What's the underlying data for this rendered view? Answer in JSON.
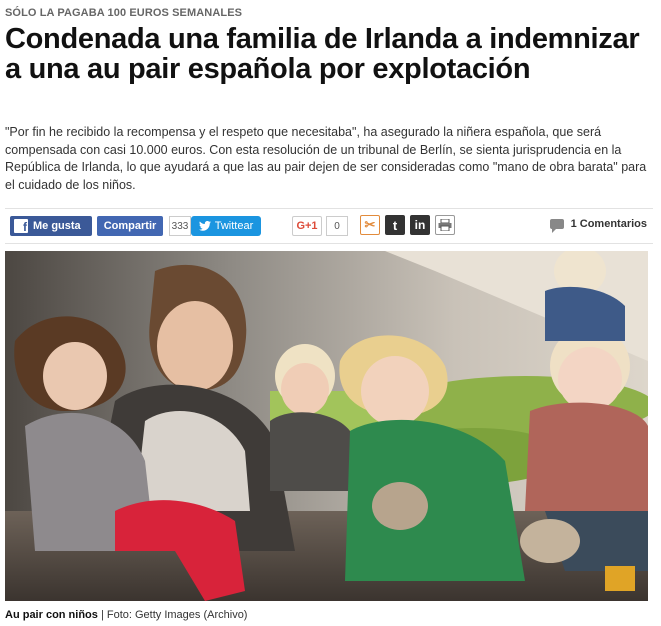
{
  "article": {
    "kicker": "SÓLO LA PAGABA 100 EUROS SEMANALES",
    "headline": "Condenada una familia de Irlanda a indemnizar a una au pair española por explotación",
    "lead": "\"Por fin he recibido la recompensa y el respeto que necesitaba\", ha asegurado la niñera española, que será compensada con casi 10.000 euros. Con esta resolución de un tribunal de Berlín, se sienta jurisprudencia en la República de Irlanda, lo que ayudará a que las au pair dejen de ser consideradas como \"mano de obra barata\" para el cuidado de los niños."
  },
  "share": {
    "fb_like_label": "Me gusta",
    "fb_share_label": "Compartir",
    "fb_share_count": "333",
    "twitter_label": "Twittear",
    "gplus_label": "G+1",
    "gplus_count": "0",
    "comments_label": "1 Comentarios"
  },
  "photo": {
    "caption_title": "Au pair con niños",
    "caption_credit": " | Foto: Getty Images (Archivo)"
  },
  "icons": {
    "facebook": "facebook-icon",
    "twitter": "twitter-bird-icon",
    "meneame": "meneame-icon",
    "tumblr": "tumblr-icon",
    "linkedin": "linkedin-icon",
    "print": "printer-icon",
    "comments": "comment-bubble-icon"
  },
  "colors": {
    "facebook": "#3b5998",
    "twitter": "#1b95e0",
    "gplus": "#dd4b39"
  }
}
